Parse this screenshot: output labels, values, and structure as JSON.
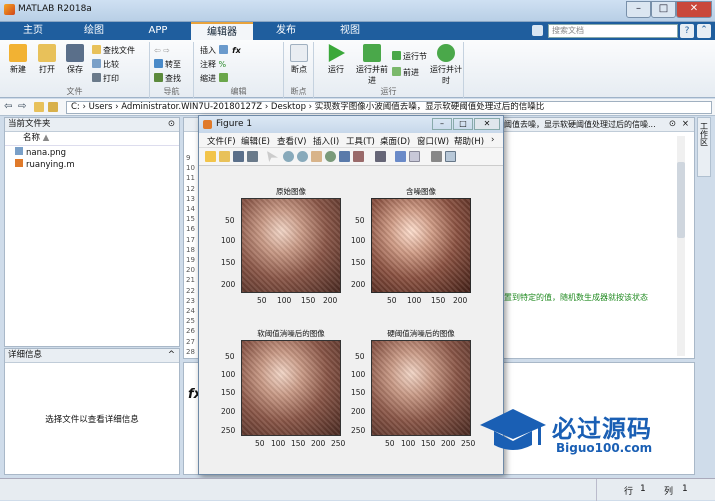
{
  "window": {
    "title": "MATLAB R2018a"
  },
  "ribbon_tabs": [
    {
      "label": "主页"
    },
    {
      "label": "绘图"
    },
    {
      "label": "APP"
    },
    {
      "label": "编辑器",
      "active": true
    },
    {
      "label": "发布"
    },
    {
      "label": "视图"
    }
  ],
  "search": {
    "placeholder": "搜索文档"
  },
  "ribbon": {
    "file": {
      "new": "新建",
      "open": "打开",
      "save": "保存",
      "find_file": "查找文件",
      "compare": "比较",
      "print": "打印",
      "group": "文件"
    },
    "nav": {
      "goto": "转至",
      "find": "查找",
      "group": "导航"
    },
    "edit": {
      "insert": "插入",
      "comment": "注释",
      "indent": "缩进",
      "group": "编辑"
    },
    "breakpoints": {
      "label": "断点",
      "group": "断点"
    },
    "run": {
      "run": "运行",
      "run_advance": "运行并前进",
      "run_section": "运行节",
      "advance": "前进",
      "run_time": "运行并计时",
      "group": "运行"
    }
  },
  "address": {
    "segments": "C: › Users › Administrator.WIN7U-20180127Z › Desktop › 实现数字图像小波阈值去噪，显示软硬阈值处理过后的信噪比"
  },
  "current_folder": {
    "title": "当前文件夹",
    "col_name": "名称",
    "files": [
      "nana.png",
      "ruanying.m"
    ]
  },
  "details": {
    "title": "详细信息",
    "message": "选择文件以查看详细信息"
  },
  "editor": {
    "tab_text": "阈值去噪，显示软硬阈值处理过后的信噪...",
    "comment_text": "设置到特定的值，随机数生成器就按该状态",
    "line_numbers": [
      "9",
      "10",
      "11",
      "12",
      "13",
      "14",
      "15",
      "16",
      "17",
      "18",
      "19",
      "20",
      "21",
      "22",
      "23",
      "24",
      "25",
      "26",
      "27",
      "28"
    ]
  },
  "command_window": {
    "prompt": "fx"
  },
  "figure": {
    "title": "Figure 1",
    "menu": [
      "文件(F)",
      "编辑(E)",
      "查看(V)",
      "插入(I)",
      "工具(T)",
      "桌面(D)",
      "窗口(W)",
      "帮助(H)"
    ],
    "subplots": [
      {
        "title": "原始图像",
        "yticks": [
          "50",
          "100",
          "150",
          "200"
        ],
        "xticks": [
          "50",
          "100",
          "150",
          "200"
        ]
      },
      {
        "title": "含噪图像",
        "yticks": [
          "50",
          "100",
          "150",
          "200"
        ],
        "xticks": [
          "50",
          "100",
          "150",
          "200"
        ]
      },
      {
        "title": "软阈值消噪后的图像",
        "yticks": [
          "50",
          "100",
          "150",
          "200",
          "250"
        ],
        "xticks": [
          "50",
          "100",
          "150",
          "200",
          "250"
        ]
      },
      {
        "title": "硬阈值消噪后的图像",
        "yticks": [
          "50",
          "100",
          "150",
          "200",
          "250"
        ],
        "xticks": [
          "50",
          "100",
          "150",
          "200",
          "250"
        ]
      }
    ]
  },
  "status": {
    "row_label": "行",
    "row": "1",
    "col_label": "列",
    "col": "1"
  },
  "side_tab": "工作区",
  "watermark": {
    "main": "必过源码",
    "sub": "Biguo100.com"
  }
}
